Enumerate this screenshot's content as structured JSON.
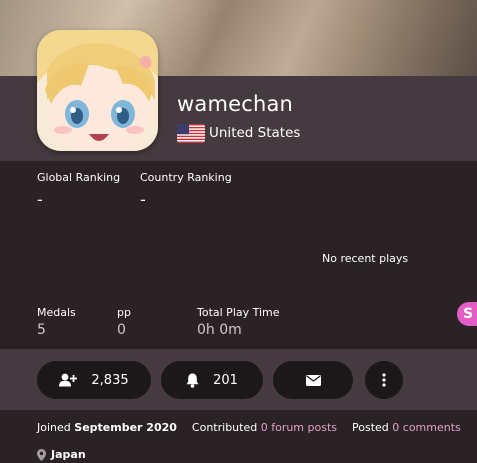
{
  "profile": {
    "username": "wamechan",
    "country": "United States",
    "flag": "us-flag-icon"
  },
  "ranking": {
    "global_label": "Global Ranking",
    "global_value": "-",
    "country_label": "Country Ranking",
    "country_value": "-"
  },
  "recent": {
    "empty_text": "No recent plays"
  },
  "stats": {
    "medals_label": "Medals",
    "medals_value": "5",
    "pp_label": "pp",
    "pp_value": "0",
    "playtime_label": "Total Play Time",
    "playtime_value": "0h 0m"
  },
  "supporter": {
    "badge_text": "S"
  },
  "actions": {
    "followers_count": "2,835",
    "subscribers_count": "201",
    "message_icon": "envelope-icon",
    "more_icon": "vertical-dots-icon"
  },
  "footer": {
    "joined_prefix": "Joined",
    "joined_date": "September 2020",
    "contributed_prefix": "Contributed",
    "forum_posts": "0 forum posts",
    "posted_prefix": "Posted",
    "comments": "0 comments",
    "location": "Japan"
  },
  "colors": {
    "background": "#2b2226",
    "header_bar": "#453a3f",
    "button_bg": "#1c1719",
    "link": "#e0a0c8",
    "supporter": "#e25ec6"
  }
}
